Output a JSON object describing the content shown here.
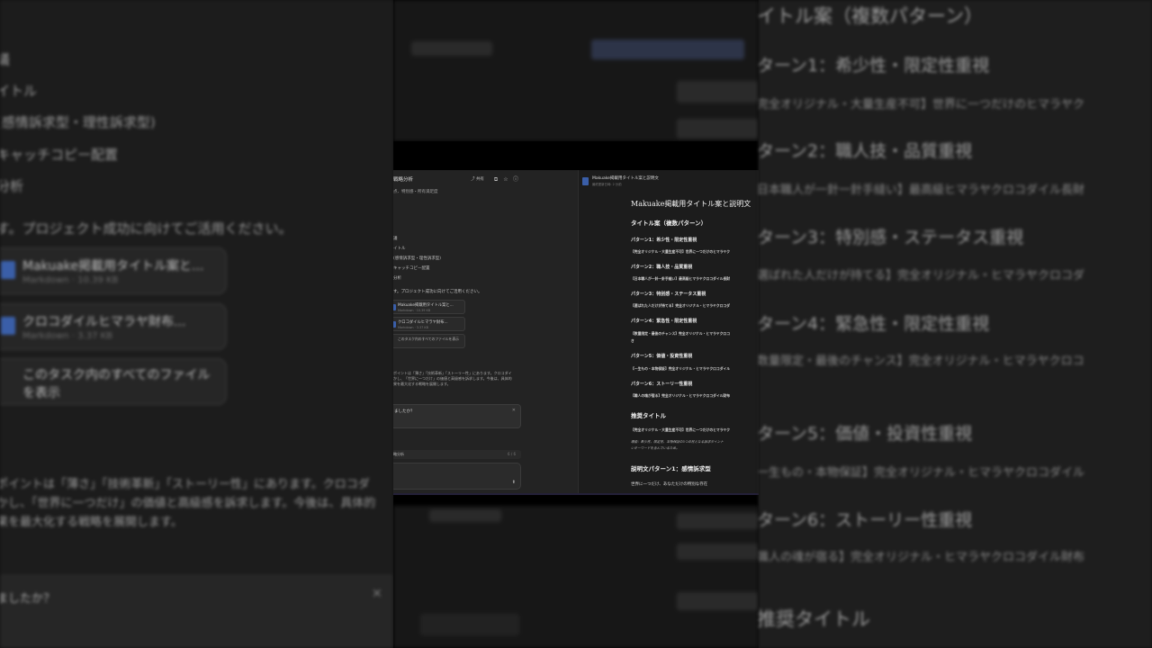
{
  "left_bg": {
    "items": [
      "議",
      "イトル",
      "(感情訴求型・理性訴求型)",
      "キャッチコピー配置",
      "分析"
    ],
    "closing": "す。プロジェクト成功に向けてご活用ください。",
    "files": [
      {
        "name": "Makuake掲載用タイトル案と...",
        "meta": "Markdown · 10.39 KB"
      },
      {
        "name": "クロコダイルヒマラヤ財布...",
        "meta": "Markdown · 3.37 KB"
      }
    ],
    "show_all": "このタスク内のすべてのファイルを表示",
    "body_lines": [
      "ポイントは「薄さ」「技術革新」「ストーリー性」にあります。クロコダ",
      "かし、「世界に一つだけ」の価値と高級感を訴求します。今後は、具体的",
      "果を最大化する戦略を展開します。"
    ],
    "question": "ましたか？"
  },
  "right_bg": {
    "heading": "イトル案（複数パターン）",
    "patterns": [
      {
        "title": "ターン1：希少性・限定性重視",
        "sample": "完全オリジナル・大量生産不可】世界に一つだけのヒマラヤク"
      },
      {
        "title": "ターン2：職人技・品質重視",
        "sample": "日本職人が一針一針手縫い】最高級ヒマラヤクロコダイル長財"
      },
      {
        "title": "ターン3：特別感・ステータス重視",
        "sample": "選ばれた人だけが持てる】完全オリジナル・ヒマラヤクロコダ"
      },
      {
        "title": "ターン4：緊急性・限定性重視",
        "sample": "数量限定・最後のチャンス】完全オリジナル・ヒマラヤクロコ"
      },
      {
        "title": "ターン5：価値・投資性重視",
        "sample": "一生もの・本物保証】完全オリジナル・ヒマラヤクロコダイル"
      },
      {
        "title": "ターン6：ストーリー性重視",
        "sample": "職人の魂が宿る】完全オリジナル・ヒマラヤクロコダイル財布"
      }
    ],
    "footer": "推奨タイトル"
  },
  "chat": {
    "title": "戦略分析",
    "subtitle": "点、特別感・所有満足度",
    "toolbar": {
      "share": "共有"
    },
    "list": [
      "議",
      "イトル",
      "(感情訴求型・理性訴求型)",
      "キャッチコピー配置",
      "分析"
    ],
    "closing": "す。プロジェクト成功に向けてご活用ください。",
    "files": [
      {
        "name": "Makuake掲載用タイトル案と...",
        "meta": "Markdown · 10.39 KB"
      },
      {
        "name": "クロコダイルヒマラヤ財布...",
        "meta": "Markdown · 3.37 KB"
      }
    ],
    "show_all": "このタスク内のすべてのファイルを表示",
    "body": [
      "ポイントは「薄さ」「技術革新」「ストーリー性」にあります。クロコダイ",
      "かし、「世界に一つだけ」の価値と高級感を訴求します。今後は、具体的",
      "果を最大化する戦略を展開します。"
    ],
    "question": "ましたか？",
    "task_label": "略分析",
    "task_count": "6 / 6"
  },
  "preview": {
    "file_title": "Makuake掲載用タイトル案と説明文",
    "file_sub": "最終更新日時: 2 分前",
    "h1": "Makuake掲載用タイトル案と説明文",
    "h2_titles": "タイトル案（複数パターン）",
    "patterns": [
      {
        "title": "パターン1：希少性・限定性重視",
        "sample": "【完全オリジナル・大量生産不可】世界に一つだけのヒマラヤク"
      },
      {
        "title": "パターン2：職人技・品質重視",
        "sample": "【日本職人が一針一針手縫い】最高級ヒマラヤクロコダイル長財"
      },
      {
        "title": "パターン3：特別感・ステータス重視",
        "sample": "【選ばれた人だけが持てる】完全オリジナル・ヒマラヤクロコダ"
      },
      {
        "title": "パターン4：緊急性・限定性重視",
        "sample": "【数量限定・最後のチャンス】完全オリジナル・ヒマラヤクロコ",
        "sample2": "き"
      },
      {
        "title": "パターン5：価値・投資性重視",
        "sample": "【一生もの・本物保証】完全オリジナル・ヒマラヤクロコダイル"
      },
      {
        "title": "パターン6：ストーリー性重視",
        "sample": "【職人の魂が宿る】完全オリジナル・ヒマラヤクロコダイル財布"
      }
    ],
    "h2_recommended": "推奨タイトル",
    "recommended": "【完全オリジナル・大量生産不可】世界に一つだけのヒマラヤク",
    "reason_1": "理由：希少性、限定性、本物保証の3つの柱となる訴求ポイント",
    "reason_2": "いキーワードを含んでいるため。",
    "h2_desc": "説明文パターン1：感情訴求型",
    "desc_line": "世界に一つだけ、あなただけの特別な存在"
  },
  "colors": {
    "accent_doc": "#3a5ea8",
    "panel_bg": "#232323",
    "preview_bg": "#1c1c1c"
  }
}
